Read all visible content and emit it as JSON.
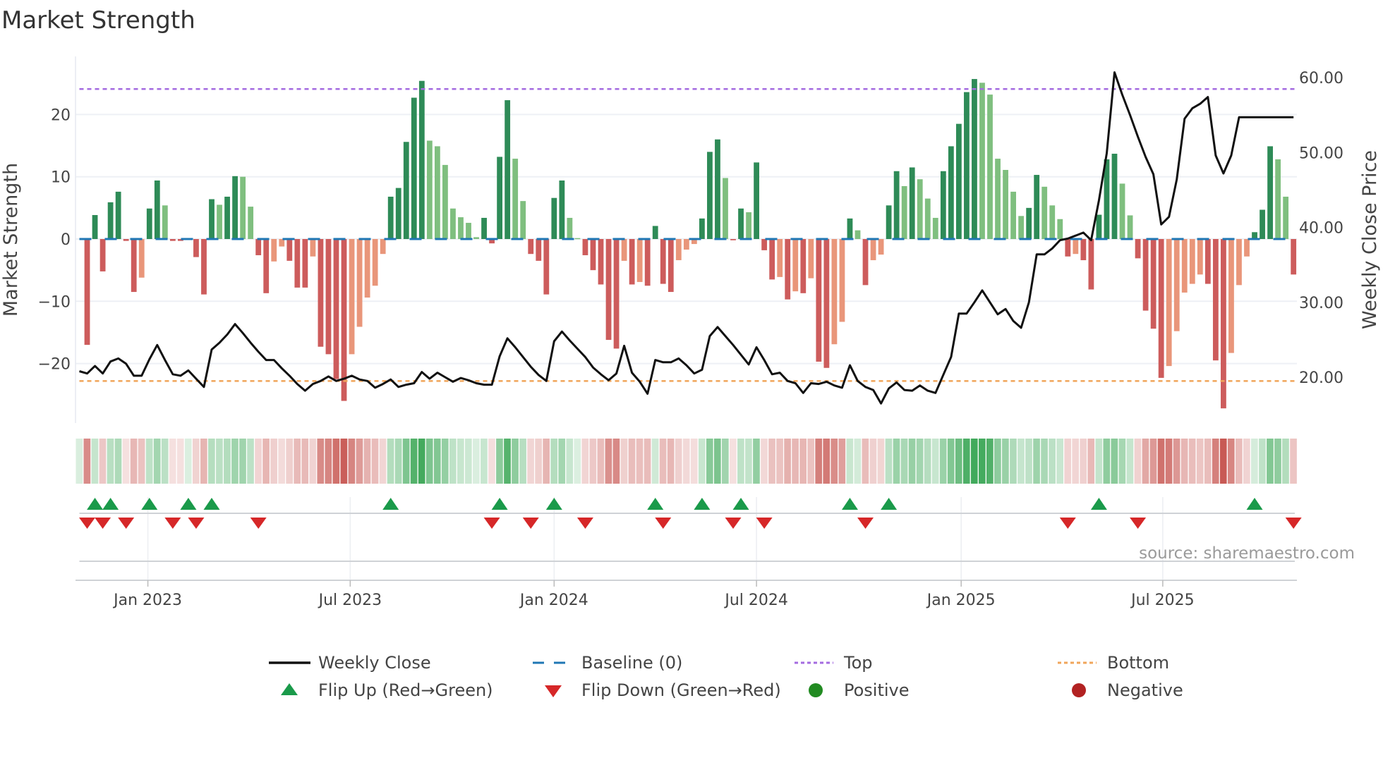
{
  "chart_data": {
    "type": "bar",
    "title": "Market Strength",
    "ylabel": "Market Strength",
    "ylabel_right": "Weekly Close Price",
    "ylim": [
      -29.6,
      29.3
    ],
    "ylim_right": [
      13.9,
      62.8
    ],
    "yticks": [
      {
        "value": 20,
        "label": "20"
      },
      {
        "value": 10,
        "label": "10"
      },
      {
        "value": 0,
        "label": "0"
      },
      {
        "value": -10,
        "label": "−10"
      },
      {
        "value": -20,
        "label": "−20"
      }
    ],
    "yticks_right": [
      {
        "value": 60,
        "label": "60.00"
      },
      {
        "value": 50,
        "label": "50.00"
      },
      {
        "value": 40,
        "label": "40.00"
      },
      {
        "value": 30,
        "label": "30.00"
      },
      {
        "value": 20,
        "label": "20.00"
      }
    ],
    "xticks": [
      {
        "week": 8.8,
        "label": "Jan 2023"
      },
      {
        "week": 34.8,
        "label": "Jul 2023"
      },
      {
        "week": 61.0,
        "label": "Jan 2024"
      },
      {
        "week": 87.0,
        "label": "Jul 2024"
      },
      {
        "week": 113.3,
        "label": "Jan 2025"
      },
      {
        "week": 139.2,
        "label": "Jul 2025"
      }
    ],
    "top_level": 24.1,
    "bottom_level": -22.8,
    "baseline": 0,
    "strength": [
      0.5,
      -17.0,
      3.85,
      -5.2,
      5.9,
      7.6,
      -0.3,
      -8.5,
      -6.2,
      4.9,
      9.4,
      5.4,
      -0.3,
      -0.3,
      0.1,
      -2.9,
      -8.9,
      6.4,
      5.5,
      6.8,
      10.1,
      10.0,
      5.2,
      -2.6,
      -8.7,
      -3.6,
      -1.2,
      -3.5,
      -7.8,
      -7.8,
      -2.8,
      -17.3,
      -18.5,
      -22.5,
      -26.0,
      -18.5,
      -14.1,
      -9.4,
      -7.5,
      -2.4,
      6.8,
      8.2,
      15.6,
      22.7,
      25.4,
      15.8,
      14.9,
      11.9,
      4.9,
      3.5,
      2.6,
      0.3,
      3.4,
      -0.7,
      13.2,
      22.3,
      12.9,
      6.1,
      -2.4,
      -3.5,
      -8.9,
      6.6,
      9.4,
      3.4,
      0.15,
      -2.6,
      -5.0,
      -7.3,
      -16.2,
      -17.6,
      -3.5,
      -7.3,
      -6.9,
      -7.5,
      2.1,
      -7.2,
      -8.5,
      -3.4,
      -1.7,
      -0.8,
      3.3,
      14.0,
      16.0,
      9.8,
      -0.2,
      4.9,
      4.3,
      12.3,
      -1.8,
      -6.5,
      -6.1,
      -9.7,
      -8.4,
      -8.7,
      -6.3,
      -19.7,
      -20.7,
      -16.9,
      -13.3,
      3.3,
      1.4,
      -7.4,
      -3.4,
      -2.5,
      5.4,
      10.9,
      8.5,
      11.5,
      9.6,
      6.5,
      3.4,
      10.9,
      14.9,
      18.5,
      23.6,
      25.7,
      25.1,
      23.2,
      12.9,
      11.1,
      7.6,
      3.7,
      5.0,
      10.3,
      8.4,
      5.4,
      3.2,
      -2.8,
      -2.4,
      -3.4,
      -8.1,
      3.9,
      12.8,
      13.7,
      8.9,
      3.8,
      -3.1,
      -11.5,
      -14.4,
      -22.3,
      -20.4,
      -14.8,
      -8.6,
      -7.2,
      -5.7,
      -7.2,
      -19.5,
      -27.2,
      -18.3,
      -7.4,
      -2.8,
      1.1,
      4.7,
      14.9,
      12.8,
      6.8,
      -5.7
    ],
    "weekly_close": [
      20.8,
      20.5,
      21.5,
      20.5,
      22.1,
      22.5,
      21.8,
      20.2,
      20.2,
      22.4,
      24.3,
      22.3,
      20.4,
      20.2,
      20.9,
      19.8,
      18.7,
      23.7,
      24.6,
      25.7,
      27.1,
      25.9,
      24.6,
      23.4,
      22.3,
      22.3,
      21.2,
      20.2,
      19.1,
      18.2,
      19.1,
      19.5,
      20.1,
      19.5,
      19.8,
      20.2,
      19.7,
      19.5,
      18.6,
      19.1,
      19.7,
      18.7,
      19.0,
      19.2,
      20.7,
      19.8,
      20.6,
      20.0,
      19.4,
      19.9,
      19.6,
      19.2,
      19.0,
      19.0,
      22.8,
      25.2,
      24.0,
      22.7,
      21.4,
      20.3,
      19.5,
      24.8,
      26.1,
      24.9,
      23.8,
      22.7,
      21.3,
      20.4,
      19.6,
      20.5,
      24.2,
      20.6,
      19.4,
      17.8,
      22.3,
      22.0,
      22.0,
      22.5,
      21.6,
      20.5,
      21.0,
      25.5,
      26.7,
      25.5,
      24.3,
      23.0,
      21.7,
      24.0,
      22.3,
      20.4,
      20.6,
      19.5,
      19.2,
      17.9,
      19.2,
      19.1,
      19.4,
      18.9,
      18.6,
      21.6,
      19.5,
      18.7,
      18.3,
      16.5,
      18.5,
      19.3,
      18.3,
      18.2,
      18.9,
      18.2,
      17.9,
      20.3,
      22.7,
      28.5,
      28.5,
      30.0,
      31.6,
      30.0,
      28.4,
      29.1,
      27.5,
      26.6,
      30.0,
      36.4,
      36.4,
      37.2,
      38.3,
      38.5,
      38.9,
      39.3,
      38.3,
      43.6,
      49.9,
      60.7,
      57.7,
      55.0,
      52.1,
      49.4,
      47.1,
      40.4,
      41.4,
      46.4,
      54.5,
      55.9,
      56.5,
      57.4,
      49.6,
      47.2,
      49.6,
      54.7,
      54.7,
      54.7,
      54.7,
      54.7,
      54.7,
      54.7,
      54.7
    ],
    "flip_up_weeks": [
      2,
      4,
      9,
      14,
      17,
      40,
      54,
      61,
      74,
      80,
      85,
      99,
      104,
      131,
      151
    ],
    "flip_down_weeks": [
      1,
      3,
      6,
      12,
      15,
      23,
      53,
      58,
      65,
      75,
      84,
      88,
      101,
      127,
      136,
      156
    ],
    "legend": [
      {
        "label": "Weekly Close",
        "marker": "line"
      },
      {
        "label": "Baseline (0)",
        "marker": "dash"
      },
      {
        "label": "Top",
        "marker": "dot-purple"
      },
      {
        "label": "Bottom",
        "marker": "dot-orange"
      },
      {
        "label": "Flip Up (Red→Green)",
        "marker": "triangle-up"
      },
      {
        "label": "Flip Down (Green→Red)",
        "marker": "triangle-down"
      },
      {
        "label": "Positive",
        "marker": "circle-green"
      },
      {
        "label": "Negative",
        "marker": "circle-red"
      }
    ],
    "legend_placement": "bottom",
    "grid": true,
    "colors": {
      "rising_positive": "#2e8b57",
      "falling_positive": "#7fbf7f",
      "falling_negative": "#cd5c5c",
      "rising_negative": "#e9967a",
      "baseline": "#1f77b4",
      "top": "#a46be0",
      "bottom": "#f0a55a",
      "price": "#111111",
      "flip_up": "#1a9a4a",
      "flip_down": "#d62728",
      "positive": "#228b22",
      "negative": "#b22222",
      "heat_positive": "#3aa655",
      "heat_negative": "#c85a55"
    }
  },
  "source": "source: sharemaestro.com"
}
